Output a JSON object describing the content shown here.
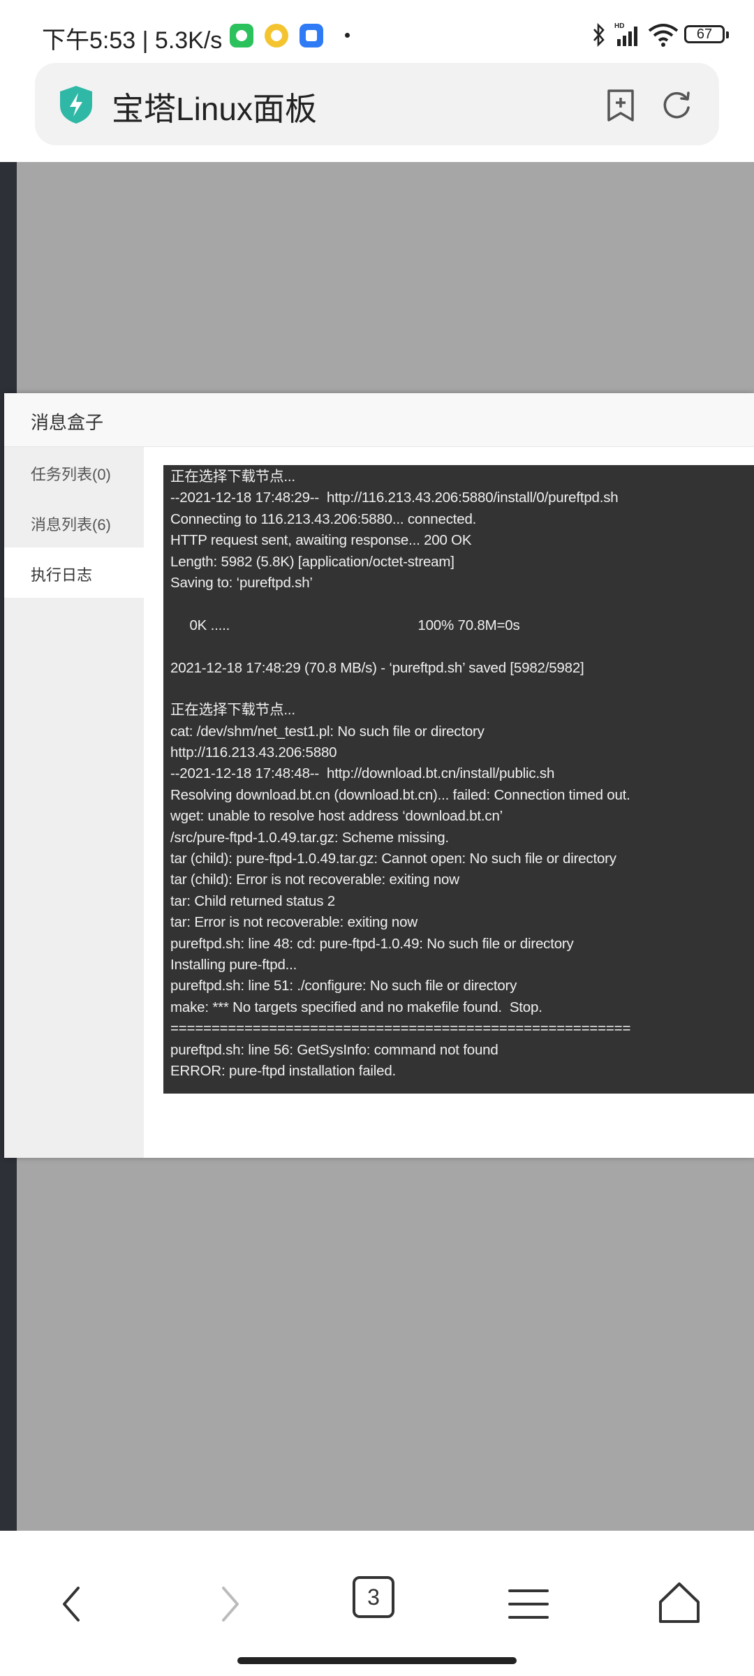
{
  "status_bar": {
    "time": "下午5:53",
    "speed": "5.3K/s",
    "network": "HD",
    "battery": "67"
  },
  "browser": {
    "page_title": "宝塔Linux面板",
    "tab_count": "3"
  },
  "modal": {
    "title": "消息盒子",
    "nav": [
      {
        "label": "任务列表(0)"
      },
      {
        "label": "消息列表(6)"
      },
      {
        "label": "执行日志"
      }
    ],
    "log_lines": [
      "正在选择下载节点...",
      "--2021-12-18 17:48:29--  http://116.213.43.206:5880/install/0/pureftpd.sh",
      "Connecting to 116.213.43.206:5880... connected.",
      "HTTP request sent, awaiting response... 200 OK",
      "Length: 5982 (5.8K) [application/octet-stream]",
      "Saving to: ‘pureftpd.sh’",
      "",
      "     0K .....                                                 100% 70.8M=0s",
      "",
      "2021-12-18 17:48:29 (70.8 MB/s) - ‘pureftpd.sh’ saved [5982/5982]",
      "",
      "正在选择下载节点...",
      "cat: /dev/shm/net_test1.pl: No such file or directory",
      "http://116.213.43.206:5880",
      "--2021-12-18 17:48:48--  http://download.bt.cn/install/public.sh",
      "Resolving download.bt.cn (download.bt.cn)... failed: Connection timed out.",
      "wget: unable to resolve host address ‘download.bt.cn’",
      "/src/pure-ftpd-1.0.49.tar.gz: Scheme missing.",
      "tar (child): pure-ftpd-1.0.49.tar.gz: Cannot open: No such file or directory",
      "tar (child): Error is not recoverable: exiting now",
      "tar: Child returned status 2",
      "tar: Error is not recoverable: exiting now",
      "pureftpd.sh: line 48: cd: pure-ftpd-1.0.49: No such file or directory",
      "Installing pure-ftpd...",
      "pureftpd.sh: line 51: ./configure: No such file or directory",
      "make: *** No targets specified and no makefile found.  Stop.",
      "========================================================",
      "pureftpd.sh: line 56: GetSysInfo: command not found",
      "ERROR: pure-ftpd installation failed."
    ]
  },
  "colors": {
    "overlay": "#a6a6a6",
    "log_bg": "#333333",
    "shield": "#2fb8a6",
    "wechat": "#2bc15c"
  }
}
